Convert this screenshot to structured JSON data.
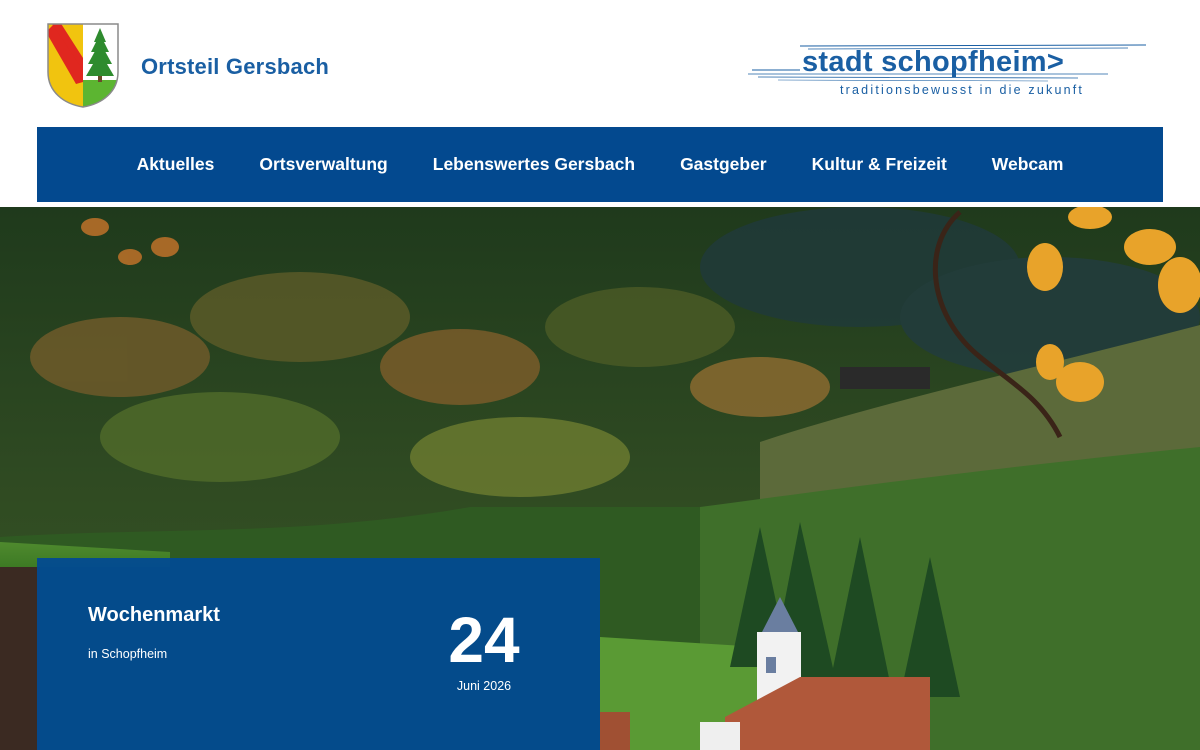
{
  "header": {
    "site_title": "Ortsteil Gersbach",
    "crest_icon": "coat-of-arms-fir-tree",
    "brand": {
      "name": "stadt schopfheim>",
      "tagline": "traditionsbewusst in die zukunft"
    }
  },
  "nav": {
    "items": [
      {
        "label": "Aktuelles"
      },
      {
        "label": "Ortsverwaltung"
      },
      {
        "label": "Lebenswertes Gersbach"
      },
      {
        "label": "Gastgeber"
      },
      {
        "label": "Kultur & Freizeit"
      },
      {
        "label": "Webcam"
      }
    ]
  },
  "event": {
    "title": "Wochenmarkt",
    "location": "in Schopfheim",
    "day": "24",
    "month": "Juni 2026"
  },
  "colors": {
    "brand_blue": "#03498f",
    "title_blue": "#1a5fa3",
    "white": "#ffffff"
  }
}
